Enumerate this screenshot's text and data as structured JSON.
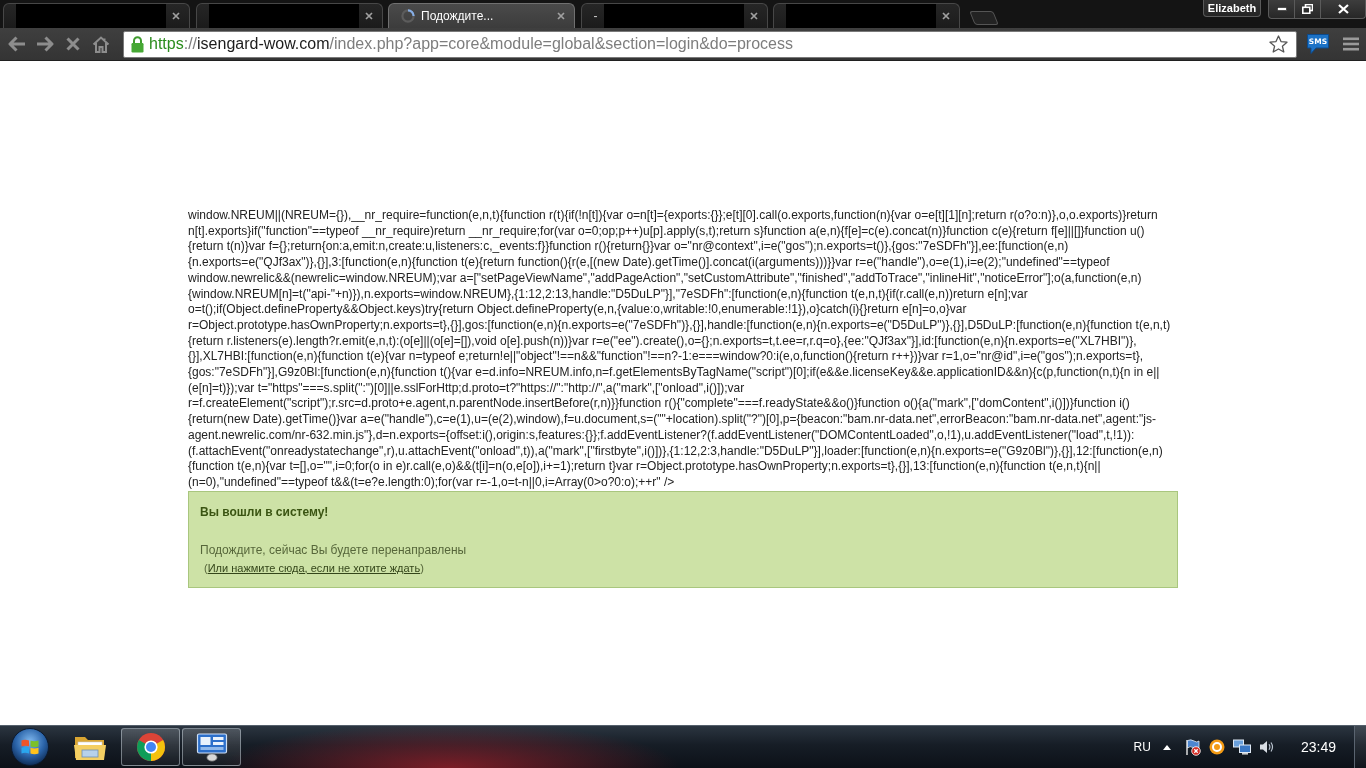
{
  "browser": {
    "tabs": [
      {
        "selected": false,
        "loading": false,
        "covered": true
      },
      {
        "selected": false,
        "loading": false,
        "covered": true
      },
      {
        "title": "Подождите...",
        "selected": true,
        "loading": true,
        "covered": false
      },
      {
        "title": "-",
        "selected": false,
        "loading": false,
        "covered": true
      },
      {
        "selected": false,
        "loading": false,
        "covered": true
      }
    ],
    "profile": "Elizabeth",
    "address": {
      "scheme": "https",
      "separator": "://",
      "host": "isengard-wow.com",
      "path": "/index.php?app=core&module=global&section=login&do=process"
    },
    "extension_label": "SMS"
  },
  "page": {
    "script_text": "window.NREUM||(NREUM={}),__nr_require=function(e,n,t){function r(t){if(!n[t]){var o=n[t]={exports:{}};e[t][0].call(o.exports,function(n){var o=e[t][1][n];return r(o?o:n)},o,o.exports)}return n[t].exports}if(\"function\"==typeof __nr_require)return __nr_require;for(var o=0;op;p++)u[p].apply(s,t);return s}function a(e,n){f[e]=c(e).concat(n)}function c(e){return f[e]||[]}function u(){return t(n)}var f={};return{on:a,emit:n,create:u,listeners:c,_events:f}}function r(){return{}}var o=\"nr@context\",i=e(\"gos\");n.exports=t()},{gos:\"7eSDFh\"}],ee:[function(e,n){n.exports=e(\"QJf3ax\")},{}],3:[function(e,n){function t(e){return function(){r(e,[(new Date).getTime()].concat(i(arguments)))}}var r=e(\"handle\"),o=e(1),i=e(2);\"undefined\"==typeof window.newrelic&&(newrelic=window.NREUM);var a=[\"setPageViewName\",\"addPageAction\",\"setCustomAttribute\",\"finished\",\"addToTrace\",\"inlineHit\",\"noticeError\"];o(a,function(e,n){window.NREUM[n]=t(\"api-\"+n)}),n.exports=window.NREUM},{1:12,2:13,handle:\"D5DuLP\"}],\"7eSDFh\":[function(e,n){function t(e,n,t){if(r.call(e,n))return e[n];var o=t();if(Object.defineProperty&&Object.keys)try{return Object.defineProperty(e,n,{value:o,writable:!0,enumerable:!1}),o}catch(i){}return e[n]=o,o}var r=Object.prototype.hasOwnProperty;n.exports=t},{}],gos:[function(e,n){n.exports=e(\"7eSDFh\")},{}],handle:[function(e,n){n.exports=e(\"D5DuLP\")},{}],D5DuLP:[function(e,n){function t(e,n,t){return r.listeners(e).length?r.emit(e,n,t):(o[e]||(o[e]=[]),void o[e].push(n))}var r=e(\"ee\").create(),o={};n.exports=t,t.ee=r,r.q=o},{ee:\"QJf3ax\"}],id:[function(e,n){n.exports=e(\"XL7HBI\")},{}],XL7HBI:[function(e,n){function t(e){var n=typeof e;return!e||\"object\"!==n&&\"function\"!==n?-1:e===window?0:i(e,o,function(){return r++})}var r=1,o=\"nr@id\",i=e(\"gos\");n.exports=t},{gos:\"7eSDFh\"}],G9z0Bl:[function(e,n){function t(){var e=d.info=NREUM.info,n=f.getElementsByTagName(\"script\")[0];if(e&&e.licenseKey&&e.applicationID&&n){c(p,function(n,t){n in e||(e[n]=t)});var t=\"https\"===s.split(\":\")[0]||e.sslForHttp;d.proto=t?\"https://\":\"http://\",a(\"mark\",[\"onload\",i()]);var r=f.createElement(\"script\");r.src=d.proto+e.agent,n.parentNode.insertBefore(r,n)}}function r(){\"complete\"===f.readyState&&o()}function o(){a(\"mark\",[\"domContent\",i()])}function i(){return(new Date).getTime()}var a=e(\"handle\"),c=e(1),u=(e(2),window),f=u.document,s=(\"\"+location).split(\"?\")[0],p={beacon:\"bam.nr-data.net\",errorBeacon:\"bam.nr-data.net\",agent:\"js-agent.newrelic.com/nr-632.min.js\"},d=n.exports={offset:i(),origin:s,features:{}};f.addEventListener?(f.addEventListener(\"DOMContentLoaded\",o,!1),u.addEventListener(\"load\",t,!1)):(f.attachEvent(\"onreadystatechange\",r),u.attachEvent(\"onload\",t)),a(\"mark\",[\"firstbyte\",i()])},{1:12,2:3,handle:\"D5DuLP\"}],loader:[function(e,n){n.exports=e(\"G9z0Bl\")},{}],12:[function(e,n){function t(e,n){var t=[],o=\"\",i=0;for(o in e)r.call(e,o)&&(t[i]=n(o,e[o]),i+=1);return t}var r=Object.prototype.hasOwnProperty;n.exports=t},{}],13:[function(e,n){function t(e,n,t){n||(n=0),\"undefined\"==typeof t&&(t=e?e.length:0);for(var r=-1,o=t-n||0,i=Array(0>o?0:o);++r\" />",
    "notice": {
      "title": "Вы вошли в систему!",
      "message": "Подождите, сейчас Вы будете перенаправлены",
      "link_open": "(",
      "link": "Или нажмите сюда, если не хотите ждать",
      "link_close": ")"
    }
  },
  "taskbar": {
    "apps": [
      {
        "running": false
      },
      {
        "running": true
      },
      {
        "running": true
      }
    ],
    "language": "RU",
    "clock": "23:49"
  }
}
